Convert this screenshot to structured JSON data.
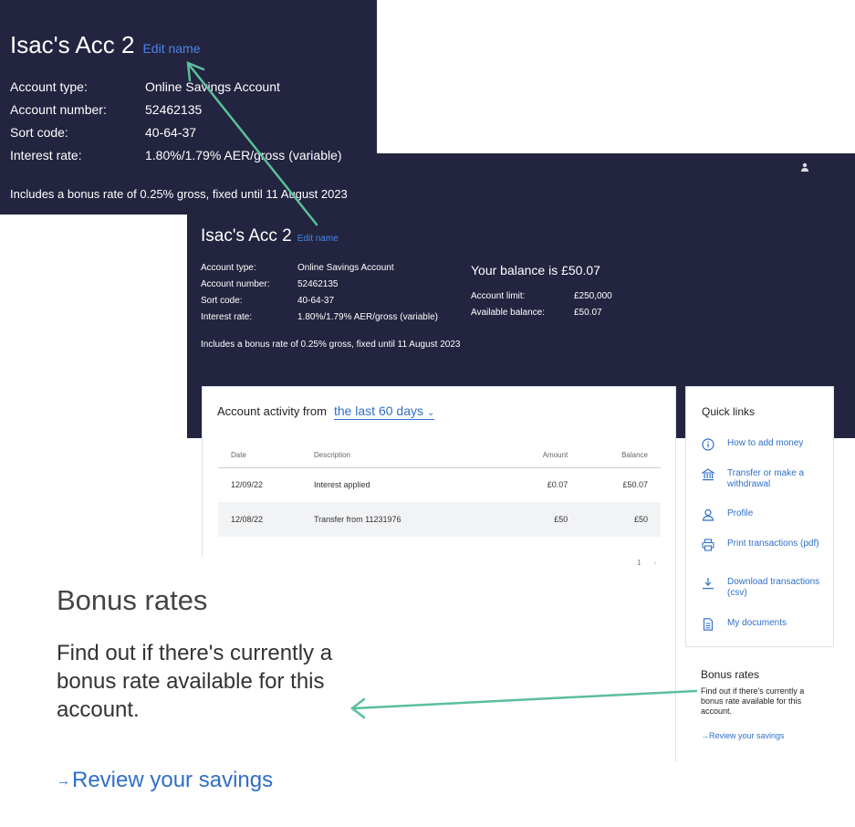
{
  "account": {
    "name": "Isac's Acc 2",
    "edit_label": "Edit name",
    "fields": [
      {
        "label": "Account type:",
        "value": "Online Savings Account"
      },
      {
        "label": "Account number:",
        "value": "52462135"
      },
      {
        "label": "Sort code:",
        "value": "40-64-37"
      },
      {
        "label": "Interest rate:",
        "value": "1.80%/1.79% AER/gross (variable)"
      }
    ],
    "bonus_note": "Includes a bonus rate of 0.25% gross, fixed until 11 August 2023"
  },
  "balance": {
    "title": "Your balance is £50.07",
    "fields": [
      {
        "label": "Account limit:",
        "value": "£250,000"
      },
      {
        "label": "Available balance:",
        "value": "£50.07"
      }
    ]
  },
  "activity": {
    "heading": "Account activity from",
    "range": "the last 60 days",
    "columns": [
      "Date",
      "Description",
      "Amount",
      "Balance"
    ],
    "rows": [
      {
        "date": "12/09/22",
        "description": "Interest applied",
        "amount": "£0.07",
        "balance": "£50.07"
      },
      {
        "date": "12/08/22",
        "description": "Transfer from 11231976",
        "amount": "£50",
        "balance": "£50"
      }
    ],
    "page": "1",
    "next": "›"
  },
  "quick_links": {
    "title": "Quick links",
    "items": [
      {
        "label": "How to add money",
        "icon": "info-icon"
      },
      {
        "label": "Transfer or make a withdrawal",
        "icon": "bank-icon"
      },
      {
        "label": "Profile",
        "icon": "user-icon"
      },
      {
        "label": "Print transactions (pdf)",
        "icon": "printer-icon"
      },
      {
        "label": "Download transactions (csv)",
        "icon": "download-icon"
      },
      {
        "label": "My documents",
        "icon": "document-icon"
      }
    ]
  },
  "bonus_rates": {
    "title": "Bonus rates",
    "text": "Find out if there's currently a bonus rate available for this account.",
    "link": "Review your savings",
    "link_icon": "→"
  },
  "colors": {
    "navy": "#23243f",
    "link": "#2f6fc7",
    "annotation_arrow": "#5bbf9a"
  }
}
